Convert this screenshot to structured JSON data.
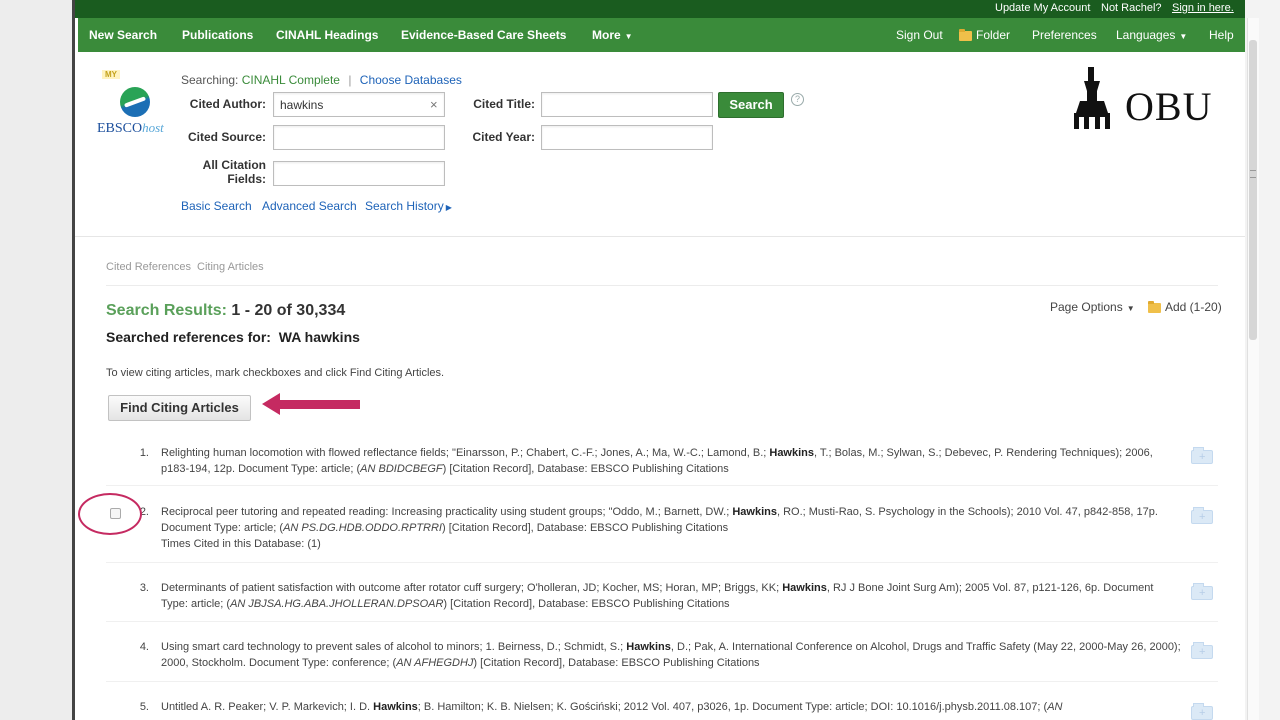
{
  "topbar": {
    "update_account": "Update My Account",
    "not_user": "Not Rachel?",
    "sign_in": "Sign in here."
  },
  "nav": {
    "left": [
      "New Search",
      "Publications",
      "CINAHL Headings",
      "Evidence-Based Care Sheets",
      "More"
    ],
    "right": {
      "sign_out": "Sign Out",
      "folder": "Folder",
      "preferences": "Preferences",
      "languages": "Languages",
      "help": "Help"
    }
  },
  "logo": {
    "my_badge": "MY",
    "brand_main": "EBSCO",
    "brand_sub": "host"
  },
  "searching": {
    "label": "Searching:",
    "database": "CINAHL Complete",
    "choose": "Choose Databases"
  },
  "form": {
    "cited_author_label": "Cited Author:",
    "cited_author_value": "hawkins",
    "cited_title_label": "Cited Title:",
    "cited_title_value": "",
    "cited_source_label": "Cited Source:",
    "cited_source_value": "",
    "cited_year_label": "Cited Year:",
    "cited_year_value": "",
    "all_citation_label_1": "All Citation",
    "all_citation_label_2": "Fields:",
    "all_citation_value": "",
    "search_button": "Search",
    "help_symbol": "?"
  },
  "sublinks": {
    "basic": "Basic Search",
    "advanced": "Advanced Search",
    "history": "Search History"
  },
  "institution_logo": "OBU",
  "breadcrumb": [
    "Cited References",
    "Citing Articles"
  ],
  "results": {
    "title_label": "Search Results:",
    "title_range": "1 - 20 of 30,334",
    "searched_for_label": "Searched references for:",
    "searched_for_value": "WA hawkins",
    "page_options": "Page Options",
    "add_label": "Add (1-20)",
    "instruction": "To view citing articles, mark checkboxes and click Find Citing Articles.",
    "find_citing_button": "Find Citing Articles"
  },
  "items": [
    {
      "num": "1.",
      "pre": "Relighting human locomotion with flowed reflectance fields; \"Einarsson, P.; Chabert, C.-F.; Jones, A.; Ma, W.-C.; Lamond, B.; ",
      "author": "Hawkins",
      "post": ", T.; Bolas, M.; Sylwan, S.; Debevec, P. Rendering Techniques); 2006, p183-194, 12p. Document Type: article; (",
      "an": "AN BDIDCBEGF",
      "tail": ") [Citation Record], Database: EBSCO Publishing Citations",
      "times_cited": ""
    },
    {
      "num": "2.",
      "pre": "Reciprocal peer tutoring and repeated reading: Increasing practicality using student groups; \"Oddo, M.; Barnett, DW.; ",
      "author": "Hawkins",
      "post": ", RO.; Musti-Rao, S. Psychology in the Schools); 2010 Vol. 47, p842-858, 17p. Document Type: article; (",
      "an": "AN PS.DG.HDB.ODDO.RPTRRI",
      "tail": ") [Citation Record], Database: EBSCO Publishing Citations",
      "times_cited": "Times Cited in this Database: (1)"
    },
    {
      "num": "3.",
      "pre": "Determinants of patient satisfaction with outcome after rotator cuff surgery; O'holleran, JD; Kocher, MS; Horan, MP; Briggs, KK; ",
      "author": "Hawkins",
      "post": ", RJ J Bone Joint Surg Am); 2005 Vol. 87, p121-126, 6p. Document Type: article; (",
      "an": "AN JBJSA.HG.ABA.JHOLLERAN.DPSOAR",
      "tail": ") [Citation Record], Database: EBSCO Publishing Citations",
      "times_cited": ""
    },
    {
      "num": "4.",
      "pre": "Using smart card technology to prevent sales of alcohol to minors; 1. Beirness, D.; Schmidt, S.; ",
      "author": "Hawkins",
      "post": ", D.; Pak, A. International Conference on Alcohol, Drugs and Traffic Safety (May 22, 2000-May 26, 2000); 2000, Stockholm. Document Type: conference; (",
      "an": "AN AFHEGDHJ",
      "tail": ") [Citation Record], Database: EBSCO Publishing Citations",
      "times_cited": ""
    },
    {
      "num": "5.",
      "pre": "Untitled A. R. Peaker; V. P. Markevich; I. D. ",
      "author": "Hawkins",
      "post": "; B. Hamilton; K. B. Nielsen; K. Gościński; 2012 Vol. 407, p3026, 1p. Document Type: article; DOI: 10.1016/j.physb.2011.08.107; (",
      "an": "AN",
      "tail": "",
      "times_cited": ""
    }
  ],
  "colors": {
    "topbar": "#1a5c1f",
    "navbar": "#3a8b3a",
    "accent_link": "#1e63b8",
    "annotation": "#c52a61"
  }
}
